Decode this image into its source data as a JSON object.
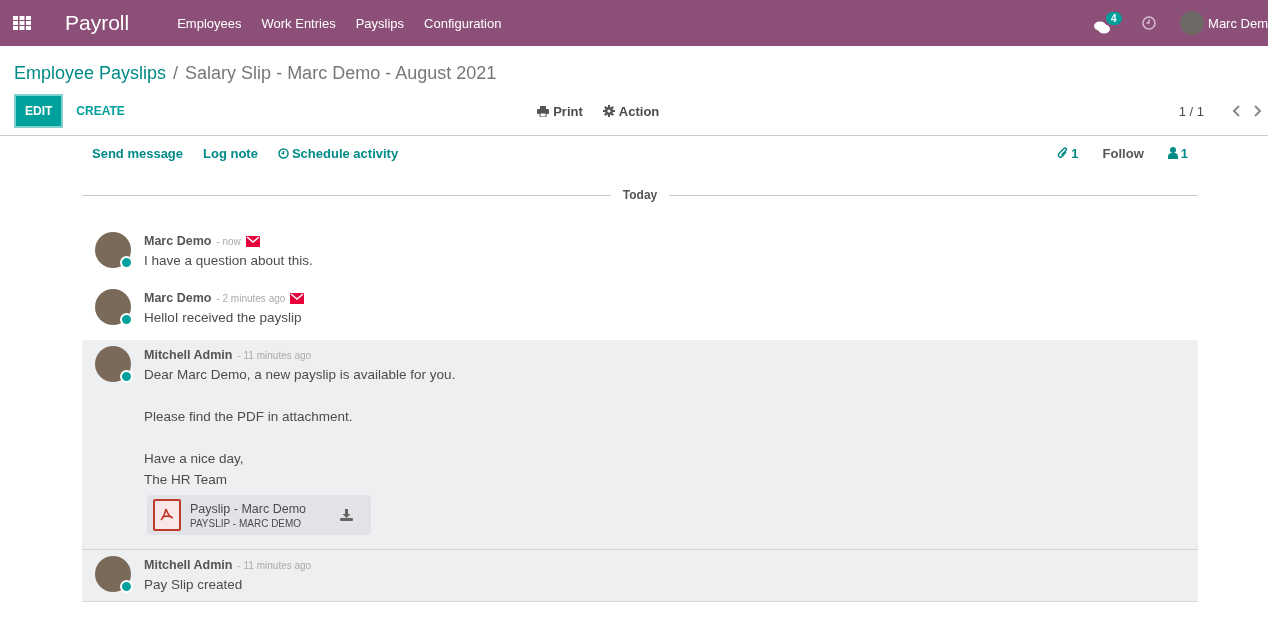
{
  "navbar": {
    "app_name": "Payroll",
    "menu": [
      "Employees",
      "Work Entries",
      "Payslips",
      "Configuration"
    ],
    "messages_count": "4",
    "user_name": "Marc Dem"
  },
  "breadcrumb": {
    "parent": "Employee Payslips",
    "separator": "/",
    "current": "Salary Slip - Marc Demo - August 2021"
  },
  "buttons": {
    "primary": "EDIT",
    "secondary": "CREATE",
    "print": "Print",
    "action": "Action"
  },
  "pager": {
    "value": "1 / 1"
  },
  "chatter": {
    "actions": [
      "Send message",
      "Log note",
      "Schedule activity"
    ],
    "attachments_count": "1",
    "follow": "Follow",
    "followers_count": "1",
    "separator": "Today",
    "messages": [
      {
        "kind": "email",
        "author": "Marc Demo",
        "time": "- now",
        "online": true,
        "paragraphs": [
          "I have a question about this."
        ]
      },
      {
        "kind": "email",
        "author": "Marc Demo",
        "time": "- 2 minutes ago",
        "online": true,
        "paragraphs": [
          "HelloI received the payslip"
        ]
      },
      {
        "kind": "note",
        "author": "Mitchell Admin",
        "time": "- 11 minutes ago",
        "online": true,
        "paragraphs": [
          "Dear Marc Demo, a new payslip is available for you.",
          "Please find the PDF in attachment.",
          "Have a nice day,\nThe HR Team"
        ],
        "attachment": {
          "name": "Payslip - Marc Demo",
          "subtitle": "PAYSLIP - MARC DEMO"
        }
      },
      {
        "kind": "note",
        "author": "Mitchell Admin",
        "time": "- 11 minutes ago",
        "online": true,
        "paragraphs": [
          "Pay Slip created"
        ]
      }
    ]
  }
}
